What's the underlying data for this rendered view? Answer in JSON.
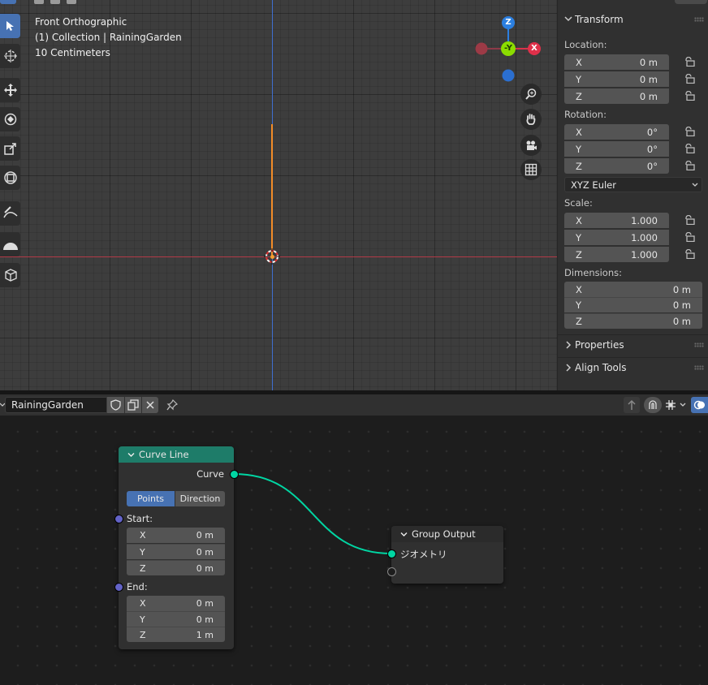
{
  "viewport": {
    "view_name": "Front Orthographic",
    "collection": "(1) Collection | RainingGarden",
    "grid_scale": "10 Centimeters",
    "gizmo": {
      "z": "Z",
      "y": "-Y",
      "x": "X"
    }
  },
  "transform_panel": {
    "title": "Transform",
    "location_label": "Location:",
    "location": [
      {
        "axis": "X",
        "value": "0 m"
      },
      {
        "axis": "Y",
        "value": "0 m"
      },
      {
        "axis": "Z",
        "value": "0 m"
      }
    ],
    "rotation_label": "Rotation:",
    "rotation": [
      {
        "axis": "X",
        "value": "0°"
      },
      {
        "axis": "Y",
        "value": "0°"
      },
      {
        "axis": "Z",
        "value": "0°"
      }
    ],
    "rotation_mode": "XYZ Euler",
    "scale_label": "Scale:",
    "scale": [
      {
        "axis": "X",
        "value": "1.000"
      },
      {
        "axis": "Y",
        "value": "1.000"
      },
      {
        "axis": "Z",
        "value": "1.000"
      }
    ],
    "dimensions_label": "Dimensions:",
    "dimensions": [
      {
        "axis": "X",
        "value": "0 m"
      },
      {
        "axis": "Y",
        "value": "0 m"
      },
      {
        "axis": "Z",
        "value": "0 m"
      }
    ],
    "properties_label": "Properties",
    "align_tools_label": "Align Tools"
  },
  "node_editor": {
    "tree_name": "RainingGarden"
  },
  "curve_line_node": {
    "title": "Curve Line",
    "output_label": "Curve",
    "mode_points": "Points",
    "mode_direction": "Direction",
    "start_label": "Start:",
    "start": [
      {
        "axis": "X",
        "value": "0 m"
      },
      {
        "axis": "Y",
        "value": "0 m"
      },
      {
        "axis": "Z",
        "value": "0 m"
      }
    ],
    "end_label": "End:",
    "end": [
      {
        "axis": "X",
        "value": "0 m"
      },
      {
        "axis": "Y",
        "value": "0 m"
      },
      {
        "axis": "Z",
        "value": "1 m"
      }
    ]
  },
  "group_output_node": {
    "title": "Group Output",
    "input_label": "ジオメトリ"
  },
  "colors": {
    "accent": "#4772b3",
    "geometry_socket": "#00d6a3",
    "vector_socket": "#6363c7",
    "node_header_geo": "#1e7c69",
    "axis_x": "#ff3352",
    "axis_y": "#8bdc00",
    "axis_z": "#2890ff"
  }
}
